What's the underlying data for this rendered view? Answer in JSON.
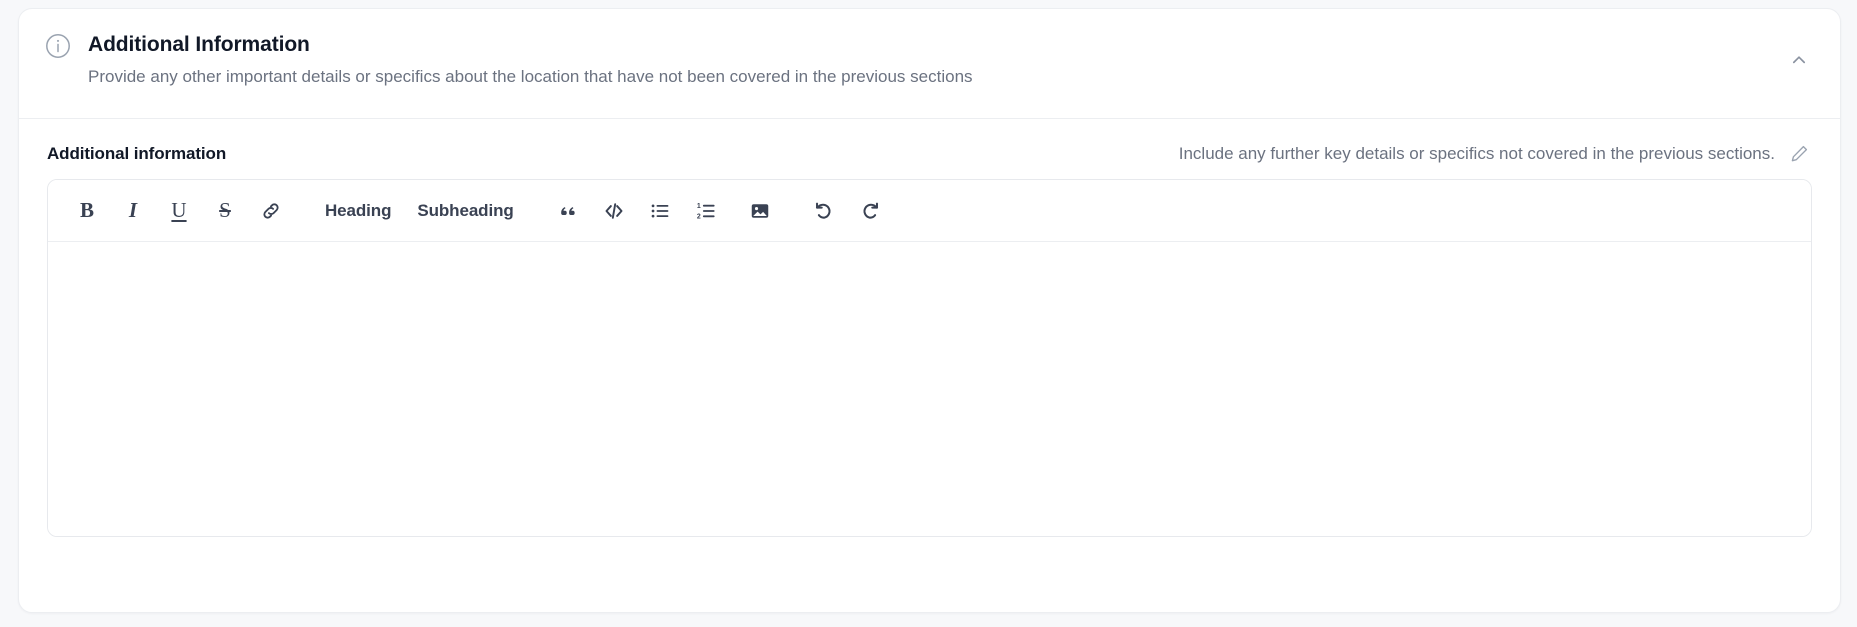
{
  "section": {
    "icon": "info-circle-icon",
    "title": "Additional Information",
    "subtitle": "Provide any other important details or specifics about the location that have not been covered in the previous sections",
    "collapse_icon": "chevron-up-icon",
    "collapsed": false
  },
  "field": {
    "label": "Additional information",
    "hint": "Include any further key details or specifics not covered in the previous sections.",
    "edit_icon": "pencil-edit-icon",
    "value": "",
    "placeholder": ""
  },
  "toolbar": {
    "items": [
      {
        "name": "bold-icon",
        "label": "B",
        "kind": "glyph-bold"
      },
      {
        "name": "italic-icon",
        "label": "I",
        "kind": "glyph-italic"
      },
      {
        "name": "underline-icon",
        "label": "U",
        "kind": "glyph-underline"
      },
      {
        "name": "strikethrough-icon",
        "label": "S",
        "kind": "glyph-strike"
      },
      {
        "name": "link-icon",
        "label": "Link",
        "kind": "svg"
      },
      {
        "name": "heading-button",
        "label": "Heading",
        "kind": "text"
      },
      {
        "name": "subheading-button",
        "label": "Subheading",
        "kind": "text"
      },
      {
        "name": "blockquote-icon",
        "label": "“",
        "kind": "glyph-quote"
      },
      {
        "name": "code-block-icon",
        "label": "</>",
        "kind": "svg"
      },
      {
        "name": "bullet-list-icon",
        "label": "Bulleted list",
        "kind": "svg"
      },
      {
        "name": "numbered-list-icon",
        "label": "Numbered list",
        "kind": "svg"
      },
      {
        "name": "image-icon",
        "label": "Insert image",
        "kind": "svg"
      },
      {
        "name": "undo-icon",
        "label": "Undo",
        "kind": "svg"
      },
      {
        "name": "redo-icon",
        "label": "Redo",
        "kind": "svg"
      }
    ],
    "heading_label": "Heading",
    "subheading_label": "Subheading",
    "code_label": "</>"
  },
  "colors": {
    "page_background": "#f7f8fa",
    "card_background": "#ffffff",
    "border": "#eceef1",
    "title_text": "#111827",
    "muted_text": "#6b7280",
    "toolbar_icon": "#3a4253"
  }
}
